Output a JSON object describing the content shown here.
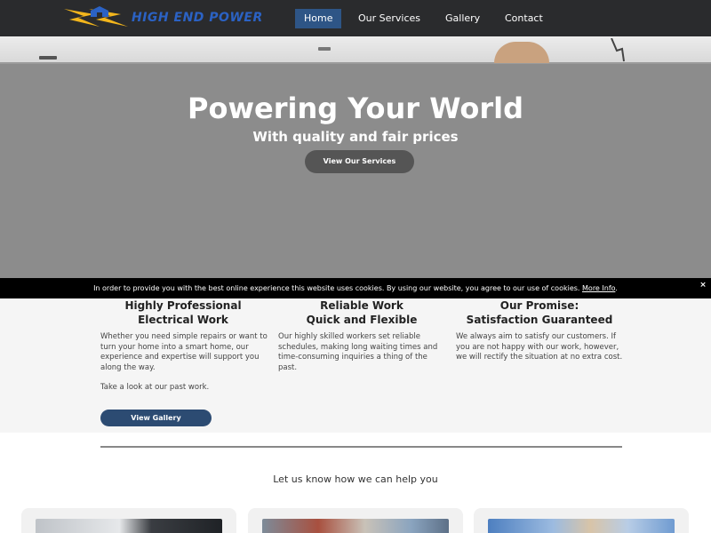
{
  "header": {
    "logo_text": "HIGH END POWER",
    "nav": [
      {
        "label": "Home",
        "active": true
      },
      {
        "label": "Our Services",
        "active": false
      },
      {
        "label": "Gallery",
        "active": false
      },
      {
        "label": "Contact",
        "active": false
      }
    ]
  },
  "hero": {
    "title": "Powering Your World",
    "subtitle": "With quality and fair prices",
    "button_label": "View Our Services"
  },
  "cookie_bar": {
    "text": "In order to provide you with the best online experience this website uses cookies. By using our website, you agree to our use of cookies.",
    "link_label": "More Info",
    "trailing": ".",
    "close_label": "×"
  },
  "features": [
    {
      "title_line1": "Highly Professional",
      "title_line2": "Electrical Work",
      "body": "Whether you need simple repairs or want to turn your home into a smart home, our experience and expertise will support you along the way.",
      "extra": "Take a look at our past work.",
      "button_label": "View Gallery"
    },
    {
      "title_line1": "Reliable Work",
      "title_line2": "Quick and Flexible",
      "body": "Our highly skilled workers set reliable schedules, making long waiting times and time-consuming inquiries a thing of the past."
    },
    {
      "title_line1": "Our Promise:",
      "title_line2": "Satisfaction Guaranteed",
      "body": "We always aim to satisfy our customers. If you are not happy with our work, however, we will rectify the situation at no extra cost."
    }
  ],
  "help": {
    "text": "Let us know how we can help you"
  },
  "colors": {
    "header_bg": "#2a2b2d",
    "nav_active": "#2e5586",
    "logo_blue": "#2b62c4",
    "logo_yellow": "#f2b51c",
    "hero_overlay": "#8c8c8c",
    "button_dark": "#555555",
    "gallery_button": "#2c4b72"
  }
}
